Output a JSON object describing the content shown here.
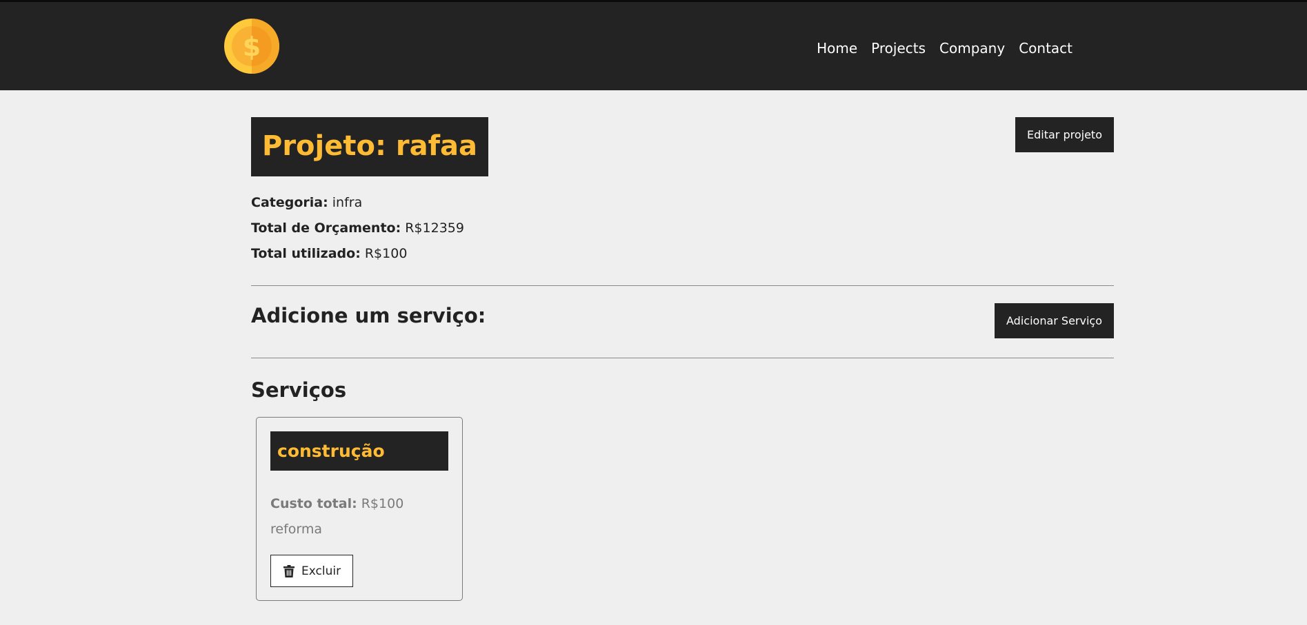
{
  "nav": {
    "logo_icon": "coin-dollar-icon",
    "items": [
      "Home",
      "Projects",
      "Company",
      "Contact"
    ]
  },
  "project": {
    "title": "Projeto: rafaa",
    "edit_label": "Editar projeto",
    "category_label": "Categoria:",
    "category_value": "infra",
    "budget_label": "Total de Orçamento:",
    "budget_value": "R$12359",
    "used_label": "Total utilizado:",
    "used_value": "R$100"
  },
  "add_service": {
    "title": "Adicione um serviço:",
    "button_label": "Adicionar Serviço"
  },
  "services": {
    "title": "Serviços",
    "items": [
      {
        "name": "construção",
        "cost_label": "Custo total:",
        "cost_value": "R$100",
        "description": "reforma",
        "delete_label": "Excluir",
        "delete_icon": "trash-icon"
      }
    ]
  },
  "colors": {
    "dark": "#232323",
    "accent": "#ffbb33",
    "background": "#efefef"
  }
}
